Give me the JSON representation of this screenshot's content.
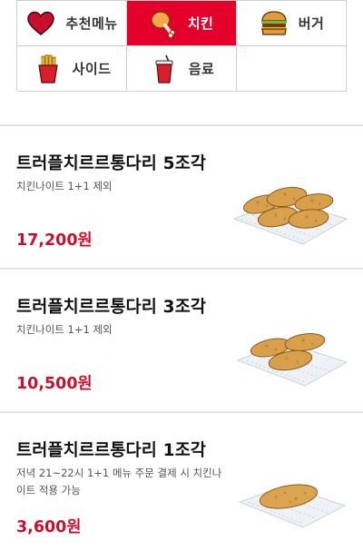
{
  "categories": [
    {
      "label": "추천메뉴",
      "icon": "heart-icon",
      "active": false
    },
    {
      "label": "치킨",
      "icon": "chicken-drumstick-icon",
      "active": true
    },
    {
      "label": "버거",
      "icon": "burger-icon",
      "active": false
    },
    {
      "label": "사이드",
      "icon": "fries-icon",
      "active": false
    },
    {
      "label": "음료",
      "icon": "drink-cup-icon",
      "active": false
    },
    {
      "label": "",
      "icon": "",
      "active": false
    }
  ],
  "menu": {
    "items": [
      {
        "name": "트러플치르르통다리 5조각",
        "desc": "치킨나이트 1+1 제외",
        "price": "17,200원",
        "image": "truffle-chicken-5pc-image"
      },
      {
        "name": "트러플치르르통다리 3조각",
        "desc": "치킨나이트 1+1 제외",
        "price": "10,500원",
        "image": "truffle-chicken-3pc-image"
      },
      {
        "name": "트러플치르르통다리 1조각",
        "desc": "저녁 21~22시 1+1 메뉴 주문 결제 시 치킨나이트 적용 가능",
        "price": "3,600원",
        "image": "truffle-chicken-1pc-image"
      }
    ]
  },
  "colors": {
    "accent": "#e4002b",
    "price": "#c8102e",
    "border": "#cfcfcf"
  }
}
